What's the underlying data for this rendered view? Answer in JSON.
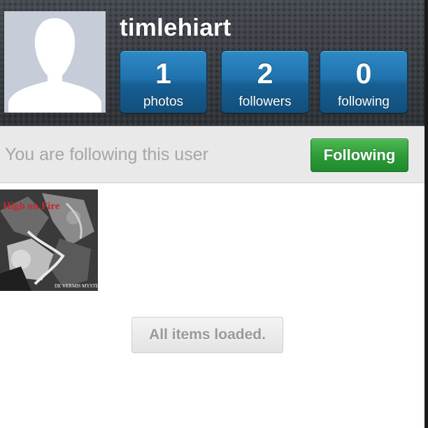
{
  "profile": {
    "username": "timlehiart",
    "avatar_icon": "default-avatar-silhouette-icon"
  },
  "stats": [
    {
      "count": "1",
      "label": "photos"
    },
    {
      "count": "2",
      "label": "followers"
    },
    {
      "count": "0",
      "label": "following"
    }
  ],
  "follow_bar": {
    "status_text": "You are following this user",
    "button_label": "Following"
  },
  "photos": [
    {
      "title_text": "High on Fire",
      "subtitle_text": "DE VERMIS MYSTERIIS"
    }
  ],
  "footer": {
    "loaded_text": "All items loaded."
  },
  "colors": {
    "header_bg": "#3a3f44",
    "stat_blue": "#1f72ad",
    "following_green": "#2c9a38",
    "status_gray": "#a6a6a6"
  }
}
